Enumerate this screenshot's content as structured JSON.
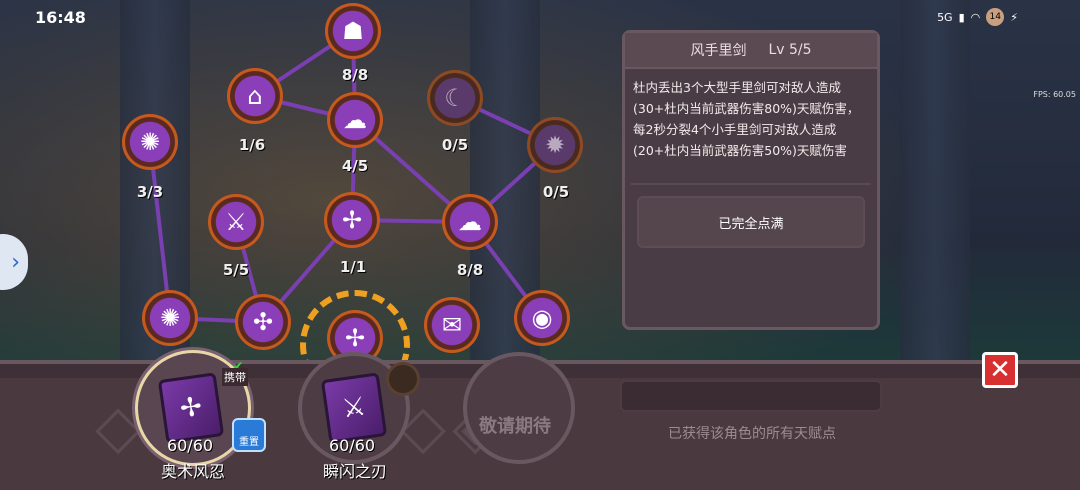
{
  "status_bar": {
    "time": "16:48",
    "network": "5G",
    "battery": "14"
  },
  "fps_text": "FPS: 60.05",
  "tree": {
    "nodes": [
      {
        "id": "n1",
        "icon": "hood-icon",
        "glyph": "☗",
        "level": "8/8",
        "dim": false
      },
      {
        "id": "n2",
        "icon": "hat-icon",
        "glyph": "⌂",
        "level": "1/6",
        "dim": false
      },
      {
        "id": "n3",
        "icon": "cloud-skull-icon",
        "glyph": "☁",
        "level": "4/5",
        "dim": false
      },
      {
        "id": "n4",
        "icon": "sickle-icon",
        "glyph": "☾",
        "level": "0/5",
        "dim": true
      },
      {
        "id": "n5",
        "icon": "net-icon",
        "glyph": "✺",
        "level": "3/3",
        "dim": false
      },
      {
        "id": "n6",
        "icon": "spiky-icon",
        "glyph": "✹",
        "level": "0/5",
        "dim": true
      },
      {
        "id": "n7",
        "icon": "crossed-blades-icon",
        "glyph": "⚔",
        "level": "5/5",
        "dim": false
      },
      {
        "id": "n8",
        "icon": "shuriken-icon",
        "glyph": "✢",
        "level": "1/1",
        "dim": false
      },
      {
        "id": "n9",
        "icon": "cloud-icon",
        "glyph": "☁",
        "level": "8/8",
        "dim": false
      },
      {
        "id": "n10",
        "icon": "web-icon",
        "glyph": "✺",
        "level": "",
        "dim": false
      },
      {
        "id": "n11",
        "icon": "tools-icon",
        "glyph": "✣",
        "level": "",
        "dim": false
      },
      {
        "id": "n12",
        "icon": "shuriken-small-icon",
        "glyph": "✢",
        "level": "",
        "dim": false
      },
      {
        "id": "n13",
        "icon": "scroll-icon",
        "glyph": "✉",
        "level": "",
        "dim": false
      },
      {
        "id": "n14",
        "icon": "eye-icon",
        "glyph": "◉",
        "level": "",
        "dim": false
      }
    ]
  },
  "detail": {
    "name": "风手里剑",
    "level": "Lv 5/5",
    "description": "杜内丢出3个大型手里剑可对敌人造成(30+杜内当前武器伤害80%)天赋伤害，每2秒分裂4个小手里剑可对敌人造成(20+杜内当前武器伤害50%)天赋伤害",
    "status": "已完全点满"
  },
  "slots": {
    "a": {
      "count": "60/60",
      "name": "奥术风忍",
      "carry": "携带",
      "reset": "重置"
    },
    "b": {
      "count": "60/60",
      "name": "瞬闪之刃"
    },
    "c": {
      "label": "敬请期待"
    }
  },
  "note": "已获得该角色的所有天赋点"
}
